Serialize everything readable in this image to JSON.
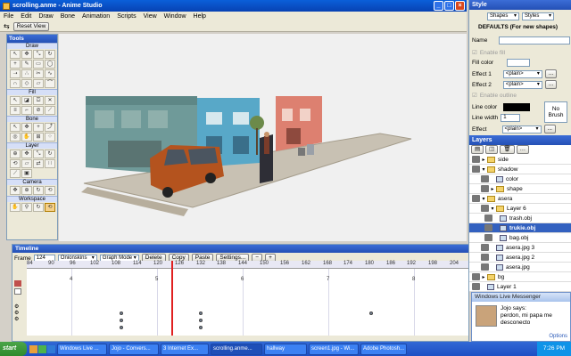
{
  "window": {
    "title": "scrolling.anme - Anime Studio",
    "menus": [
      "File",
      "Edit",
      "Draw",
      "Bone",
      "Animation",
      "Scripts",
      "View",
      "Window",
      "Help"
    ],
    "reset_view": "Reset View"
  },
  "tools": {
    "title": "Tools",
    "sections": [
      "Draw",
      "Fill",
      "Bone",
      "Layer",
      "Camera",
      "Workspace"
    ]
  },
  "canvas": {
    "label": "Frame 124"
  },
  "style_panel": {
    "title": "Style",
    "shapes_label": "Shapes",
    "styles_label": "Styles",
    "defaults_text": "DEFAULTS (For new shapes)",
    "name_label": "Name",
    "enable_fill_label": "Enable fill",
    "fill_color_label": "Fill color",
    "effect1_label": "Effect 1",
    "effect1_value": "<plain>",
    "effect2_label": "Effect 2",
    "effect2_value": "<plain>",
    "enable_outline_label": "Enable outline",
    "line_color_label": "Line color",
    "line_width_label": "Line width",
    "line_width_value": "1",
    "no_brush_label": "No Brush",
    "effect_label": "Effect",
    "effect_value": "<plain>"
  },
  "layers_panel": {
    "title": "Layers",
    "rows": [
      {
        "name": "side"
      },
      {
        "name": "shadow"
      },
      {
        "name": "color"
      },
      {
        "name": "shape"
      },
      {
        "name": "asera"
      },
      {
        "name": "Layer 6"
      },
      {
        "name": "trash.obj"
      },
      {
        "name": "trukie.obj"
      },
      {
        "name": "bag.obj"
      },
      {
        "name": "asera.jpg 3"
      },
      {
        "name": "asera.jpg 2"
      },
      {
        "name": "asera.jpg"
      },
      {
        "name": "bg"
      },
      {
        "name": "Layer 1"
      }
    ]
  },
  "timeline": {
    "title": "Timeline",
    "frame_label": "Frame",
    "frame_value": "124",
    "onionskins": "Onionskins",
    "graph_mode": "Graph Mode",
    "delete": "Delete",
    "copy": "Copy",
    "paste": "Paste",
    "settings": "Settings...",
    "minus": "−",
    "plus": "+",
    "ruler": [
      "84",
      "90",
      "96",
      "102",
      "108",
      "114",
      "120",
      "126",
      "132",
      "138",
      "144",
      "150",
      "156",
      "162",
      "168",
      "174",
      "180",
      "186",
      "192",
      "198",
      "204"
    ],
    "second_markers": [
      "4",
      "5",
      "6",
      "7",
      "8"
    ]
  },
  "messenger": {
    "title": "Windows Live Messenger",
    "says": "Jojo says:",
    "message": "perdon, mi papa me desconecto",
    "options": "Options"
  },
  "taskbar": {
    "start": "start",
    "tasks": [
      "Windows Live ...",
      "Jojo - Convers...",
      "3 Internet Ex...",
      "scrolling.anme...",
      "hallway",
      "screen1.jpg - Wi...",
      "Adobe Photosh..."
    ],
    "clock": "7:26 PM"
  }
}
